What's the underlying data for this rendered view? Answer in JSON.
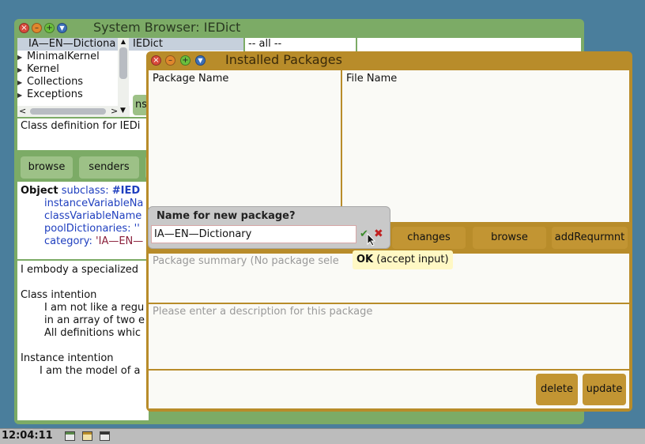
{
  "system_browser": {
    "title": "System Browser: IEDict",
    "packages": [
      {
        "label": "IA—EN—Dictiona",
        "selected": true,
        "expandable": false
      },
      {
        "label": "MinimalKernel",
        "selected": false,
        "expandable": true
      },
      {
        "label": "Kernel",
        "selected": false,
        "expandable": true
      },
      {
        "label": "Collections",
        "selected": false,
        "expandable": true
      },
      {
        "label": "Exceptions",
        "selected": false,
        "expandable": true
      }
    ],
    "class_name": "IEDict",
    "category_all": "-- all --",
    "partial_tab": "ns",
    "class_definition_label": "Class definition for IEDi",
    "buttons": {
      "browse": "browse",
      "senders": "senders"
    },
    "code": {
      "object": "Object",
      "subclass": "subclass:",
      "class_symbol": "#IED",
      "ivars": "instanceVariableNa",
      "cvars": "classVariableName",
      "pools": "poolDictionaries: ''",
      "category_kw": "category:",
      "category_val": "'IA—EN—"
    },
    "comment": {
      "line1": "I embody a specialized",
      "class_intention": "Class intention",
      "ci1": "I am not like a regu",
      "ci2": "in an array of two e",
      "ci3": "All definitions whic",
      "instance_intention": "Instance intention",
      "ii1": "I am the model of a"
    }
  },
  "installed_packages": {
    "title": "Installed Packages",
    "col_package": "Package Name",
    "col_file": "File Name",
    "buttons": {
      "changes": "changes",
      "browse": "browse",
      "add_requirement": "addRequrmnt",
      "delete": "delete",
      "update": "update"
    },
    "summary_placeholder": "Package summary (No package sele",
    "description_placeholder": "Please enter a description for this package"
  },
  "dialog": {
    "title": "Name for new package?",
    "value": "IA—EN—Dictionary"
  },
  "tooltip": {
    "bold": "OK",
    "rest": "(accept input)"
  },
  "taskbar": {
    "clock": "12:04:11"
  },
  "colors": {
    "desktop": "#4a7e9c",
    "browser_frame": "#7cab66",
    "packages_frame": "#b88c2a",
    "tooltip": "#fff8c4"
  }
}
